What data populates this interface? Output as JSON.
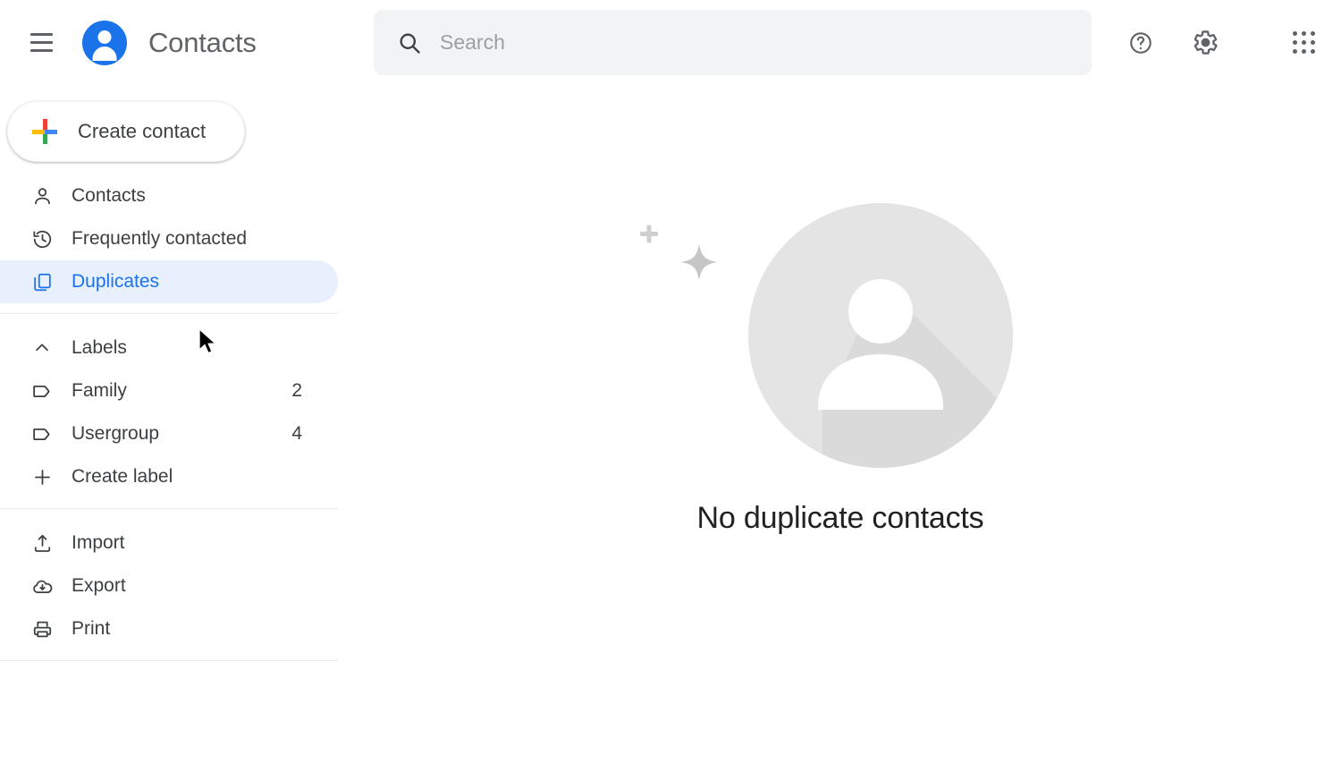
{
  "header": {
    "menu_icon": "hamburger-menu-icon",
    "app_logo": "contacts-avatar-logo",
    "title": "Contacts",
    "search": {
      "icon": "search-icon",
      "placeholder": "Search",
      "value": ""
    },
    "actions": [
      {
        "name": "help-icon",
        "label": "Help"
      },
      {
        "name": "settings-gear-icon",
        "label": "Settings"
      },
      {
        "name": "google-apps-grid-icon",
        "label": "Google apps"
      }
    ]
  },
  "sidebar": {
    "create_button": {
      "label": "Create contact",
      "icon": "google-plus-icon"
    },
    "nav_items": [
      {
        "label": "Contacts",
        "icon": "person-icon",
        "selected": false,
        "count": ""
      },
      {
        "label": "Frequently contacted",
        "icon": "history-icon",
        "selected": false,
        "count": ""
      },
      {
        "label": "Duplicates",
        "icon": "duplicate-copy-icon",
        "selected": true,
        "count": ""
      }
    ],
    "labels_section": {
      "header_label": "Labels",
      "header_icon": "chevron-up-icon",
      "items": [
        {
          "label": "Family",
          "icon": "label-tag-icon",
          "count": "2"
        },
        {
          "label": "Usergroup",
          "icon": "label-tag-icon",
          "count": "4"
        }
      ],
      "create_label": {
        "label": "Create label",
        "icon": "plus-icon"
      }
    },
    "tools": [
      {
        "label": "Import",
        "icon": "upload-icon"
      },
      {
        "label": "Export",
        "icon": "cloud-download-icon"
      },
      {
        "label": "Print",
        "icon": "printer-icon"
      }
    ]
  },
  "main": {
    "empty_state": {
      "illustration": "empty-contact-avatar-illustration",
      "message": "No duplicate contacts"
    }
  },
  "colors": {
    "accent_blue": "#1a73e8",
    "selected_pill": "#e8f0fe",
    "search_background": "#f1f3f4",
    "text_primary": "#202124",
    "text_secondary": "#5f6368",
    "divider": "#e8eaed",
    "illustration_gray": "#e0e0e0",
    "google_red": "#ea4335",
    "google_yellow": "#fbbc04",
    "google_green": "#34a853",
    "google_blue": "#4285f4"
  }
}
